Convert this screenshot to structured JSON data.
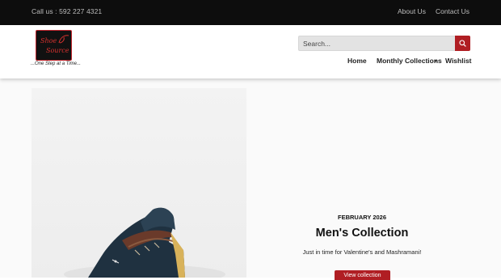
{
  "topbar": {
    "call": "Call us :  592 227 4321",
    "links": [
      "About Us",
      "Contact Us"
    ]
  },
  "logo": {
    "line1": "Shoe",
    "line2": "Source",
    "tagline": "...One Step at a Time..."
  },
  "search": {
    "placeholder": "Search..."
  },
  "nav": {
    "home": "Home",
    "monthly": "Monthly Collections",
    "wishlist": "Wishlist"
  },
  "hero": {
    "date": "FEBRUARY 2026",
    "title": "Men's Collection",
    "subtitle": "Just in time for Valentine's and Mashramani!",
    "button": "View collection"
  },
  "colors": {
    "accent": "#b01e23",
    "topbar_bg": "#0d0d0d"
  },
  "icons": {
    "search": "search-icon",
    "caret": "chevron-down-icon"
  }
}
